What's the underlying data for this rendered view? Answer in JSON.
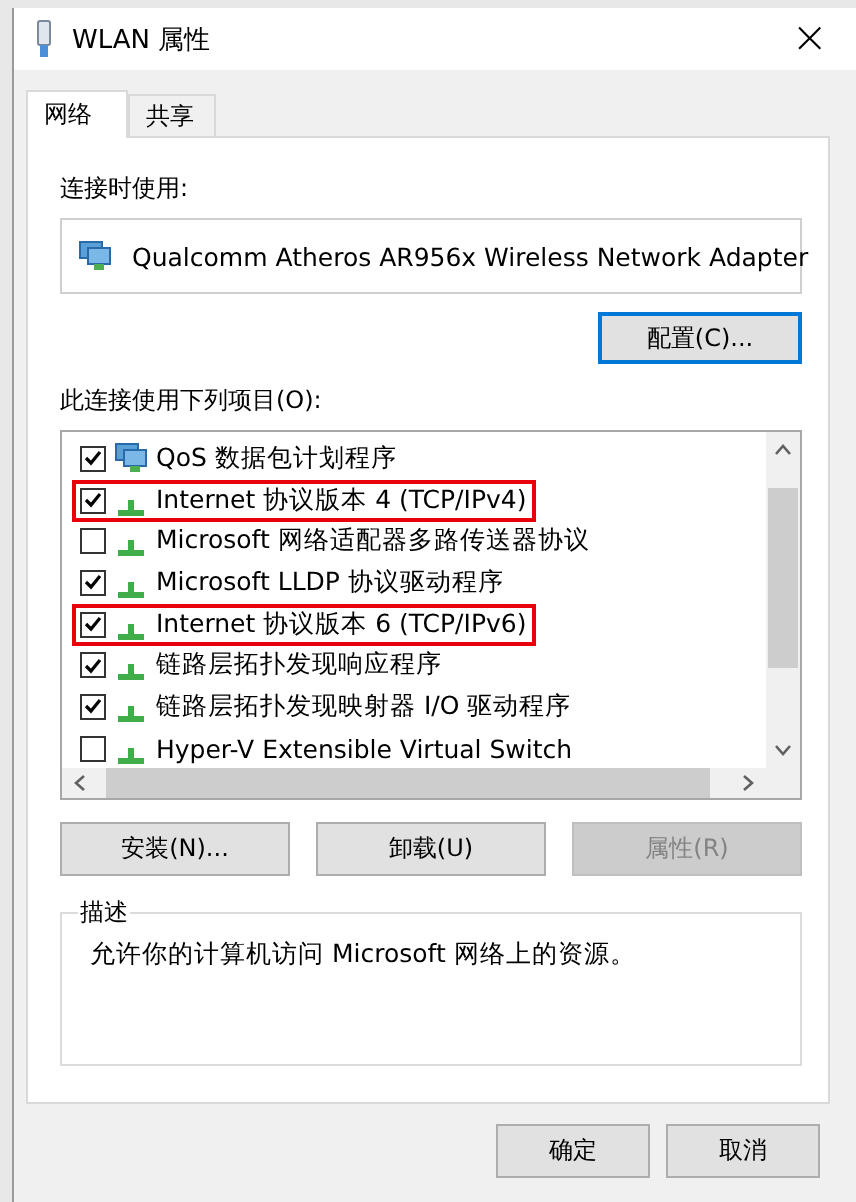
{
  "window": {
    "title": "WLAN 属性",
    "close": "×"
  },
  "tabs": [
    {
      "label": "网络",
      "selected": true
    },
    {
      "label": "共享",
      "selected": false
    }
  ],
  "connect_using": {
    "label": "连接时使用:",
    "adapter": "Qualcomm Atheros AR956x Wireless Network Adapter",
    "configure_button": "配置(C)..."
  },
  "items_label": "此连接使用下列项目(O):",
  "items": [
    {
      "kind": "service",
      "label": "QoS 数据包计划程序",
      "checked": true,
      "highlighted": false
    },
    {
      "kind": "protocol",
      "label": "Internet 协议版本 4 (TCP/IPv4)",
      "checked": true,
      "highlighted": true
    },
    {
      "kind": "protocol",
      "label": "Microsoft 网络适配器多路传送器协议",
      "checked": false,
      "highlighted": false
    },
    {
      "kind": "protocol",
      "label": "Microsoft LLDP 协议驱动程序",
      "checked": true,
      "highlighted": false
    },
    {
      "kind": "protocol",
      "label": "Internet 协议版本 6 (TCP/IPv6)",
      "checked": true,
      "highlighted": true
    },
    {
      "kind": "protocol",
      "label": "链路层拓扑发现响应程序",
      "checked": true,
      "highlighted": false
    },
    {
      "kind": "protocol",
      "label": "链路层拓扑发现映射器 I/O 驱动程序",
      "checked": true,
      "highlighted": false
    },
    {
      "kind": "protocol",
      "label": "Hyper-V Extensible Virtual Switch",
      "checked": false,
      "highlighted": false
    }
  ],
  "item_buttons": [
    {
      "label": "安装(N)...",
      "disabled": false
    },
    {
      "label": "卸载(U)",
      "disabled": false
    },
    {
      "label": "属性(R)",
      "disabled": true
    }
  ],
  "description": {
    "label": "描述",
    "text": "允许你的计算机访问 Microsoft 网络上的资源。"
  },
  "dialog_buttons": [
    "确定",
    "取消"
  ]
}
